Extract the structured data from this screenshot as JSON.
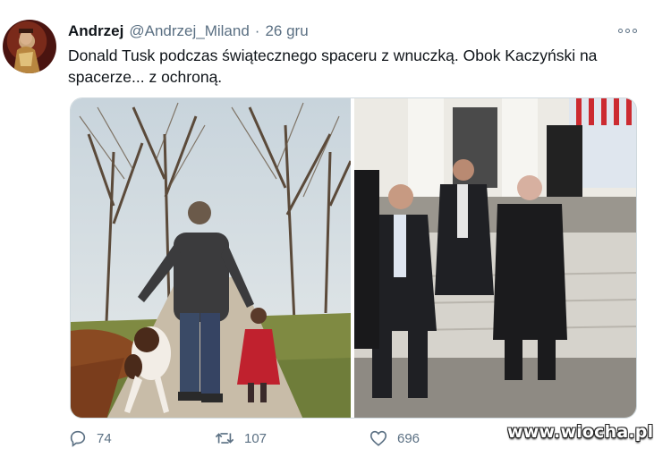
{
  "tweet": {
    "author_name": "Andrzej",
    "author_handle": "@Andrzej_Miland",
    "separator": "·",
    "date": "26 gru",
    "text": "Donald Tusk podczas świątecznego spaceru z wnuczką. Obok Kaczyński na spacerze... z ochroną.",
    "media": [
      "walk-with-granddaughter-photo",
      "walk-with-security-photo"
    ]
  },
  "actions": {
    "reply_count": "74",
    "retweet_count": "107",
    "like_count": "696"
  },
  "watermark": "www.wiocha.pl",
  "colors": {
    "text": "#0f1419",
    "secondary": "#5b7083",
    "border": "#cfd9de"
  },
  "icons": [
    "more-icon",
    "reply-icon",
    "retweet-icon",
    "like-icon"
  ]
}
